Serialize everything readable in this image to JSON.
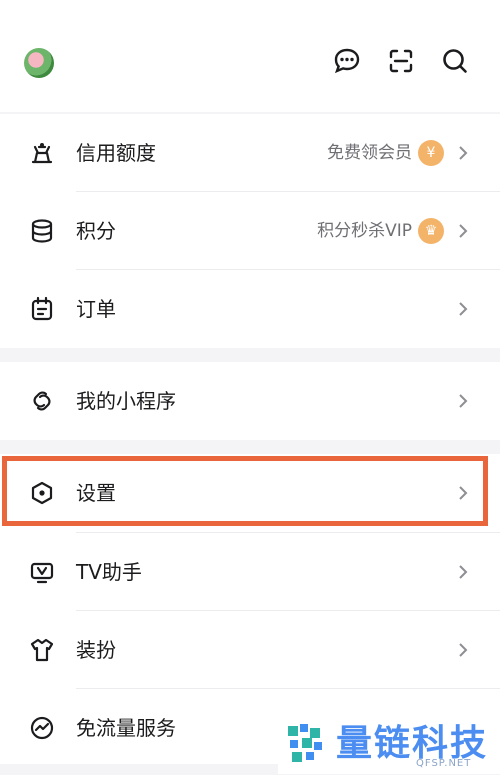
{
  "menu": [
    {
      "label": "信用额度",
      "sub": "免费领会员",
      "badge": "¥"
    },
    {
      "label": "积分",
      "sub": "积分秒杀VIP",
      "badge": "♛"
    },
    {
      "label": "订单"
    },
    {
      "label": "我的小程序"
    },
    {
      "label": "设置"
    },
    {
      "label": "TV助手"
    },
    {
      "label": "装扮"
    },
    {
      "label": "免流量服务"
    }
  ],
  "watermark": {
    "title": "量链科技",
    "site": "QFSP.NET"
  }
}
